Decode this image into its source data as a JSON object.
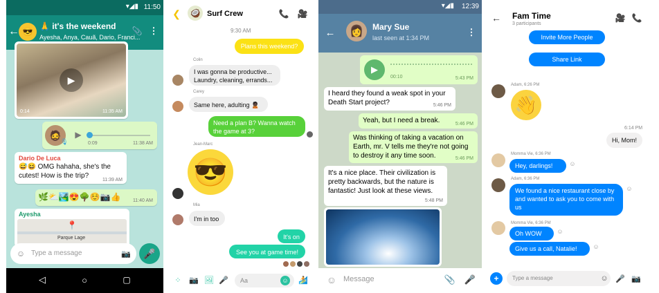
{
  "whatsapp": {
    "status_time": "11:50",
    "chat_title": "🙏 it's the weekend",
    "participants": "Ayesha, Anya, Cauã, Dario, Franci...",
    "video_duration": "0:14",
    "video_time": "11:35 AM",
    "voice_progress": "0:09",
    "voice_time": "11:38 AM",
    "sender_name": "Dario De Luca",
    "sender_msg": "😅😆 OMG hahaha, she's the cutest! How is the trip?",
    "sender_time": "11:39 AM",
    "emoji_row": "🌿⛅🏞️😍🌳☺️📷👍",
    "emoji_time": "11:40 AM",
    "location_sender": "Ayesha",
    "location_label": "Parque Lage",
    "input_placeholder": "Type a message"
  },
  "kik": {
    "chat_title": "Surf Crew",
    "timestamp": "9:30 AM",
    "msg_out_1": "Plans this weekend?",
    "name_colin": "Colin",
    "msg_colin": "I was gonna be productive... Laundry, cleaning, errands...",
    "name_carey": "Carey",
    "msg_carey": "Same here, adulting 🙎🏿",
    "msg_out_2": "Need a plan B? Wanna watch the game at 3?",
    "name_jm": "Jean-Marc",
    "name_mia": "Mia",
    "msg_mia": "I'm in too",
    "msg_out_3": "It's on",
    "msg_out_4": "See you at game time!",
    "input_placeholder": "Aa"
  },
  "telegram": {
    "status_time": "12:39",
    "contact_name": "Mary Sue",
    "last_seen": "last seen at 1:34 PM",
    "voice_duration": "00:10",
    "voice_time": "5:43 PM",
    "msg_1": "I heard they found a weak spot in your Death Start project?",
    "msg_1_time": "5:46 PM",
    "msg_2": "Yeah, but I need a break.",
    "msg_2_time": "5:46 PM",
    "msg_3": "Was thinking of taking a vacation on Earth, mr. V tells me they're not going to destroy it any time soon.",
    "msg_3_time": "5:46 PM",
    "msg_4": "It's a nice place. Their civilization is pretty backwards, but the nature is fantastic! Just look at these views.",
    "msg_4_time": "5:48 PM",
    "input_placeholder": "Message"
  },
  "messenger": {
    "chat_title": "Fam Time",
    "participants": "3 participants",
    "invite_btn": "Invite More People",
    "share_btn": "Share Link",
    "adam_time_1": "Adam, 6:26 PM",
    "time_center": "6:14 PM",
    "msg_hi_mom": "Hi, Mom!",
    "momma_time_1": "Momma Vie, 6:36 PM",
    "msg_hey": "Hey, darlings!",
    "adam_time_2": "Adam, 6:36 PM",
    "msg_restaurant": "We found a nice restaurant close by and wanted to ask you to come with us",
    "momma_time_2": "Momma Vie, 6:36 PM",
    "msg_oh_wow": "Oh WOW",
    "msg_call": "Give us a call, Natalie!",
    "input_placeholder": "Type a message"
  }
}
